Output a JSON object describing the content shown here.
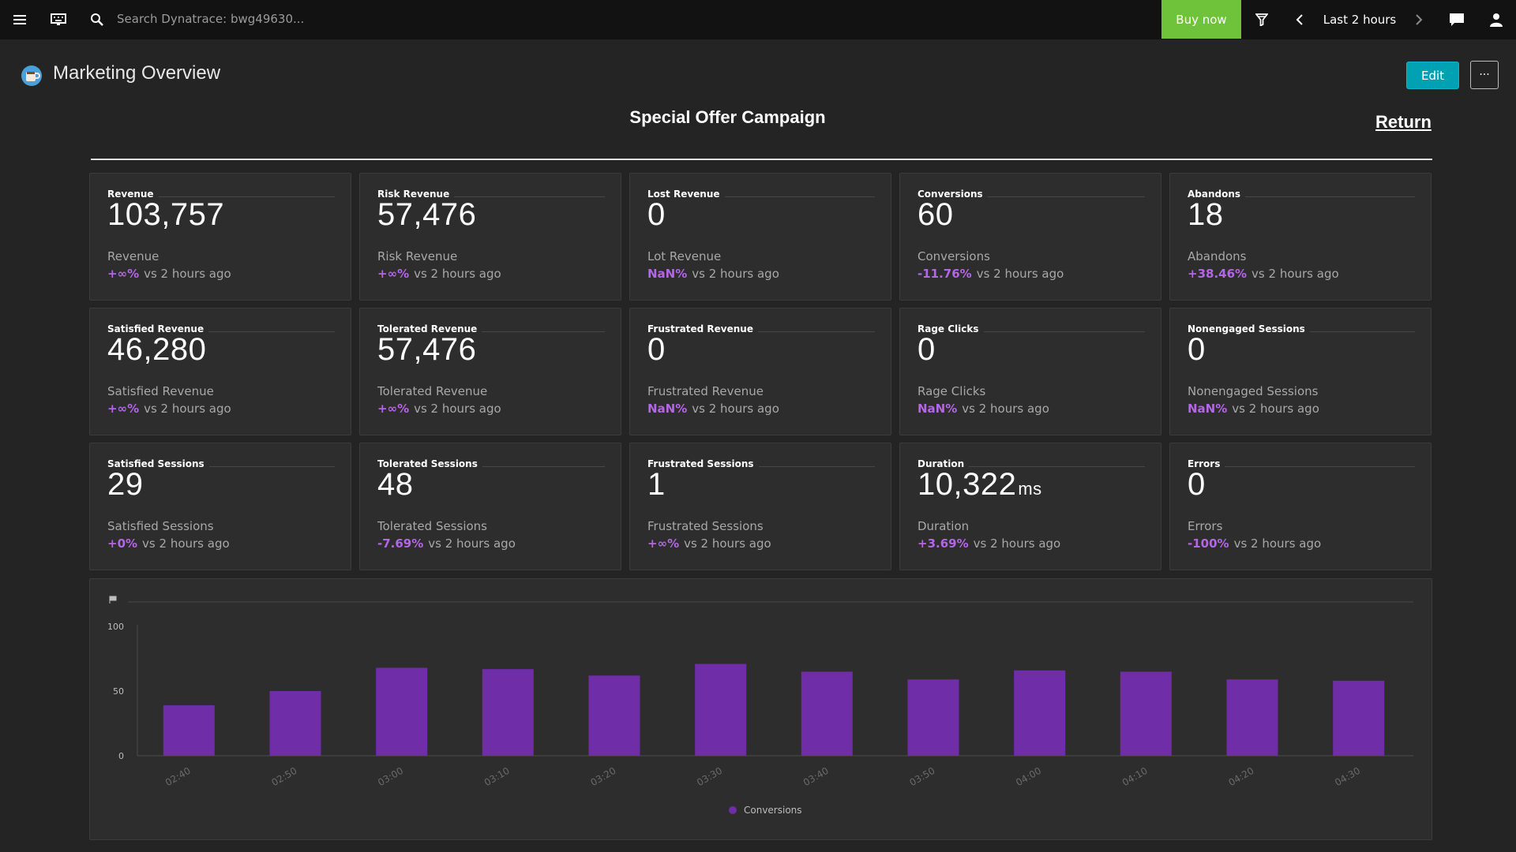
{
  "topbar": {
    "search_placeholder": "Search Dynatrace: bwg49630...",
    "buy_now": "Buy now",
    "timeframe": "Last 2 hours",
    "icons": [
      "menu-icon",
      "keyboard-icon",
      "search-icon",
      "filter-icon",
      "chevron-left-icon",
      "chevron-right-icon",
      "chat-icon",
      "user-icon"
    ]
  },
  "page": {
    "title": "Marketing Overview",
    "edit_label": "Edit",
    "more_label": "···"
  },
  "header": {
    "campaign_title": "Special Offer Campaign",
    "return_label": "Return"
  },
  "tiles": [
    {
      "title": "Revenue",
      "value": "103,757",
      "unit": "",
      "sub": "Revenue",
      "delta": "+∞%",
      "suffix": "vs 2 hours ago"
    },
    {
      "title": "Risk Revenue",
      "value": "57,476",
      "unit": "",
      "sub": "Risk Revenue",
      "delta": "+∞%",
      "suffix": "vs 2 hours ago"
    },
    {
      "title": "Lost Revenue",
      "value": "0",
      "unit": "",
      "sub": "Lot Revenue",
      "delta": "NaN%",
      "suffix": "vs 2 hours ago"
    },
    {
      "title": "Conversions",
      "value": "60",
      "unit": "",
      "sub": "Conversions",
      "delta": "-11.76%",
      "suffix": "vs 2 hours ago"
    },
    {
      "title": "Abandons",
      "value": "18",
      "unit": "",
      "sub": "Abandons",
      "delta": "+38.46%",
      "suffix": "vs 2 hours ago"
    },
    {
      "title": "Satisfied Revenue",
      "value": "46,280",
      "unit": "",
      "sub": "Satisfied Revenue",
      "delta": "+∞%",
      "suffix": "vs 2 hours ago"
    },
    {
      "title": "Tolerated Revenue",
      "value": "57,476",
      "unit": "",
      "sub": "Tolerated Revenue",
      "delta": "+∞%",
      "suffix": "vs 2 hours ago"
    },
    {
      "title": "Frustrated Revenue",
      "value": "0",
      "unit": "",
      "sub": "Frustrated Revenue",
      "delta": "NaN%",
      "suffix": "vs 2 hours ago"
    },
    {
      "title": "Rage Clicks",
      "value": "0",
      "unit": "",
      "sub": "Rage Clicks",
      "delta": "NaN%",
      "suffix": "vs 2 hours ago"
    },
    {
      "title": "Nonengaged Sessions",
      "value": "0",
      "unit": "",
      "sub": "Nonengaged Sessions",
      "delta": "NaN%",
      "suffix": "vs 2 hours ago"
    },
    {
      "title": "Satisfied Sessions",
      "value": "29",
      "unit": "",
      "sub": "Satisfied Sessions",
      "delta": "+0%",
      "suffix": "vs 2 hours ago"
    },
    {
      "title": "Tolerated Sessions",
      "value": "48",
      "unit": "",
      "sub": "Tolerated Sessions",
      "delta": "-7.69%",
      "suffix": "vs 2 hours ago"
    },
    {
      "title": "Frustrated Sessions",
      "value": "1",
      "unit": "",
      "sub": "Frustrated Sessions",
      "delta": "+∞%",
      "suffix": "vs 2 hours ago"
    },
    {
      "title": "Duration",
      "value": "10,322",
      "unit": "ms",
      "sub": "Duration",
      "delta": "+3.69%",
      "suffix": "vs 2 hours ago"
    },
    {
      "title": "Errors",
      "value": "0",
      "unit": "",
      "sub": "Errors",
      "delta": "-100%",
      "suffix": "vs 2 hours ago"
    }
  ],
  "colors": {
    "accent_purple": "#b366e6",
    "bar_purple": "#6f2da8",
    "buy_green": "#6fc33b",
    "edit_teal": "#00a1b2"
  },
  "chart_data": {
    "type": "bar",
    "categories": [
      "02:40",
      "02:50",
      "03:00",
      "03:10",
      "03:20",
      "03:30",
      "03:40",
      "03:50",
      "04:00",
      "04:10",
      "04:20",
      "04:30"
    ],
    "series": [
      {
        "name": "Conversions",
        "values": [
          39,
          50,
          68,
          67,
          62,
          71,
          65,
          59,
          66,
          65,
          59,
          58
        ]
      }
    ],
    "yticks": [
      "100",
      "50",
      "0"
    ],
    "ylim": [
      0,
      100
    ],
    "legend": "bottom-center",
    "grid": false
  }
}
